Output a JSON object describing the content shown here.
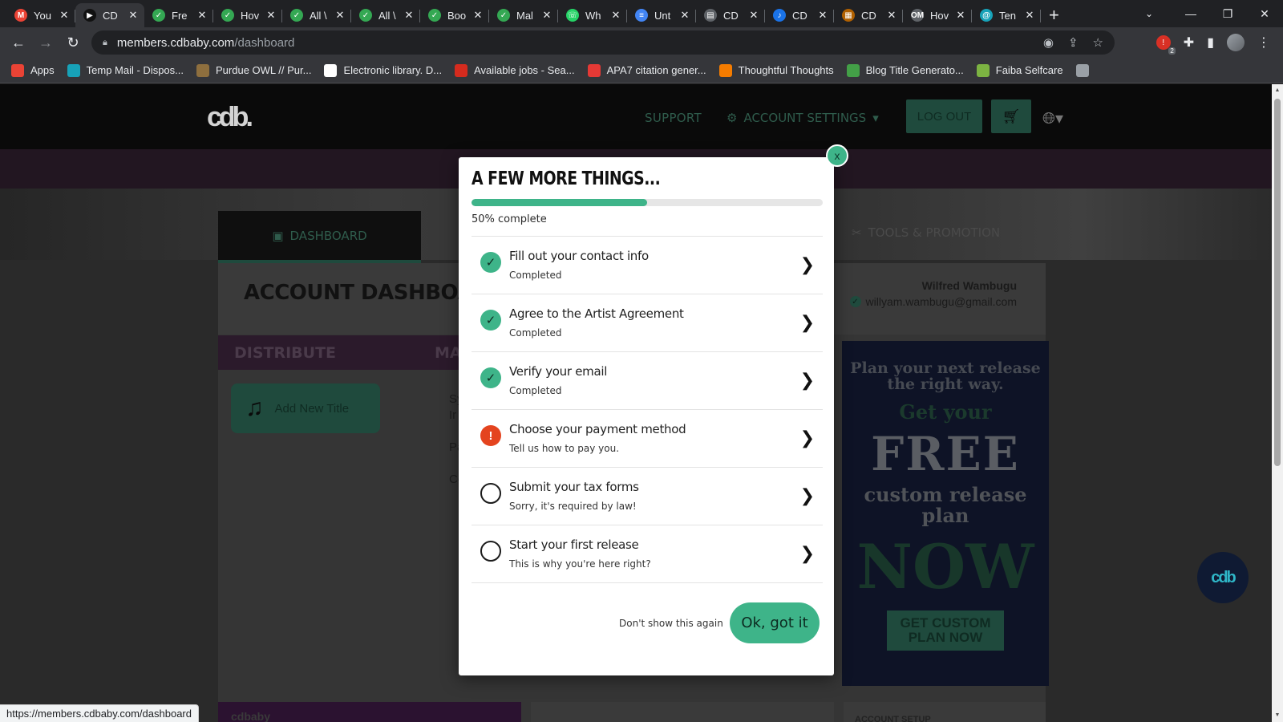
{
  "browser": {
    "tabs": [
      {
        "label": "You",
        "icon": "gmail-icon",
        "color": "#ea4335",
        "glyph": "M"
      },
      {
        "label": "CD",
        "icon": "cdbaby-tab-icon",
        "color": "#111111",
        "glyph": "▶",
        "active": true
      },
      {
        "label": "Fre",
        "icon": "check-circle-icon",
        "color": "#34a853",
        "glyph": "✓"
      },
      {
        "label": "Hov",
        "icon": "check-circle-icon",
        "color": "#34a853",
        "glyph": "✓"
      },
      {
        "label": "All \\",
        "icon": "check-circle-icon",
        "color": "#34a853",
        "glyph": "✓"
      },
      {
        "label": "All \\",
        "icon": "check-circle-icon",
        "color": "#34a853",
        "glyph": "✓"
      },
      {
        "label": "Boo",
        "icon": "check-circle-icon",
        "color": "#34a853",
        "glyph": "✓"
      },
      {
        "label": "Mal",
        "icon": "check-circle-icon",
        "color": "#34a853",
        "glyph": "✓"
      },
      {
        "label": "Wh",
        "icon": "whatsapp-icon",
        "color": "#25d366",
        "glyph": "☏"
      },
      {
        "label": "Unt",
        "icon": "google-docs-icon",
        "color": "#4285f4",
        "glyph": "≡"
      },
      {
        "label": "CD",
        "icon": "document-icon",
        "color": "#5f6368",
        "glyph": "▤"
      },
      {
        "label": "CD",
        "icon": "music-note-icon",
        "color": "#1a73e8",
        "glyph": "♪"
      },
      {
        "label": "CD",
        "icon": "archive-icon",
        "color": "#b06000",
        "glyph": "▦"
      },
      {
        "label": "Hov",
        "icon": "om-icon",
        "color": "#5f6368",
        "glyph": "OM"
      },
      {
        "label": "Ten",
        "icon": "tempmail-icon",
        "color": "#17a2b8",
        "glyph": "@"
      }
    ],
    "url_host": "members.cdbaby.com",
    "url_path": "/dashboard",
    "status_url": "https://members.cdbaby.com/dashboard",
    "bookmarks": [
      {
        "label": "Apps",
        "icon": "apps-grid-icon",
        "color": "#ea4335"
      },
      {
        "label": "Temp Mail - Dispos...",
        "icon": "tempmail-icon",
        "color": "#17a2b8"
      },
      {
        "label": "Purdue OWL // Pur...",
        "icon": "purdue-icon",
        "color": "#8e6f3e"
      },
      {
        "label": "Electronic library. D...",
        "icon": "library-icon",
        "color": "#ffffff"
      },
      {
        "label": "Available jobs - Sea...",
        "icon": "maple-leaf-icon",
        "color": "#d52b1e"
      },
      {
        "label": "APA7 citation gener...",
        "icon": "citation-icon",
        "color": "#e53935"
      },
      {
        "label": "Thoughtful Thoughts",
        "icon": "blogger-icon",
        "color": "#f57c00"
      },
      {
        "label": "Blog Title Generato...",
        "icon": "bars-icon",
        "color": "#43a047"
      },
      {
        "label": "Faiba Selfcare",
        "icon": "faiba-icon",
        "color": "#7cb342"
      },
      {
        "label": "",
        "icon": "globe-icon",
        "color": "#9aa0a6"
      }
    ],
    "extension_badge": "2"
  },
  "site": {
    "logo_text": "cdb.",
    "nav_support": "SUPPORT",
    "nav_settings": "ACCOUNT SETTINGS",
    "logout": "LOG OUT",
    "tab_dashboard": "DASHBOARD",
    "tab_tools": "TOOLS & PROMOTION",
    "account_title": "ACCOUNT DASHBOARD",
    "user_name": "Wilfred Wambugu",
    "user_email": "willyam.wambugu@gmail.com",
    "distribute": "DISTRIBUTE",
    "manage": "MA",
    "add_title": "Add New Title",
    "mid_text": [
      "Sy",
      "Ir",
      "",
      "Pa",
      "",
      "Co"
    ],
    "ad": {
      "line1": "Plan your next release the right way.",
      "line2": "Get your",
      "line3": "FREE",
      "line4": "custom release plan",
      "line5": "NOW",
      "cta": "GET CUSTOM PLAN NOW"
    },
    "bottom_left": "cdbaby",
    "bottom_right": "ACCOUNT SETUP"
  },
  "modal": {
    "close": "x",
    "title": "A FEW MORE THINGS...",
    "progress_pct": 50,
    "progress_label": "50% complete",
    "tasks": [
      {
        "title": "Fill out your contact info",
        "subtitle": "Completed",
        "status": "done"
      },
      {
        "title": "Agree to the Artist Agreement",
        "subtitle": "Completed",
        "status": "done"
      },
      {
        "title": "Verify your email",
        "subtitle": "Completed",
        "status": "done"
      },
      {
        "title": "Choose your payment method",
        "subtitle": "Tell us how to pay you.",
        "status": "warn"
      },
      {
        "title": "Submit your tax forms",
        "subtitle": "Sorry, it's required by law!",
        "status": "todo"
      },
      {
        "title": "Start your first release",
        "subtitle": "This is why you're here right?",
        "status": "todo"
      }
    ],
    "dont_show": "Don't show this again",
    "ok": "Ok, got it"
  },
  "colors": {
    "accent": "#3eb489",
    "warning": "#e4441f"
  }
}
